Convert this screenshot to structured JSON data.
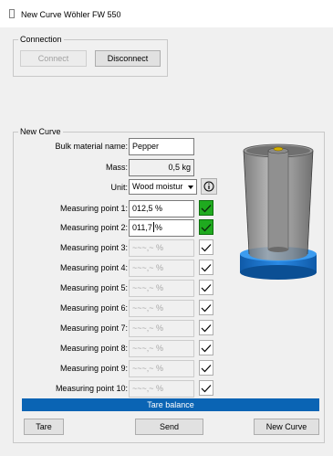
{
  "window": {
    "title": "New Curve Wöhler FW 550"
  },
  "connection": {
    "label": "Connection",
    "connect_label": "Connect",
    "disconnect_label": "Disconnect"
  },
  "curve": {
    "label": "New Curve",
    "bulk_label": "Bulk material name:",
    "bulk_value": "Pepper",
    "mass_label": "Mass:",
    "mass_value": "0,5 kg",
    "unit_label": "Unit:",
    "unit_value": "Wood moistur",
    "info_icon": "info-icon",
    "points": [
      {
        "label": "Measuring point 1:",
        "value": "012,5 %",
        "confirmed": true
      },
      {
        "label": "Measuring point 2:",
        "value_a": "011,7",
        "value_b": "%",
        "confirmed": true
      },
      {
        "label": "Measuring point 3:",
        "value": "~~~,~ %",
        "confirmed": false
      },
      {
        "label": "Measuring point 4:",
        "value": "~~~,~ %",
        "confirmed": false
      },
      {
        "label": "Measuring point 5:",
        "value": "~~~,~ %",
        "confirmed": false
      },
      {
        "label": "Measuring point 6:",
        "value": "~~~,~ %",
        "confirmed": false
      },
      {
        "label": "Measuring point 7:",
        "value": "~~~,~ %",
        "confirmed": false
      },
      {
        "label": "Measuring point 8:",
        "value": "~~~,~ %",
        "confirmed": false
      },
      {
        "label": "Measuring point 9:",
        "value": "~~~,~ %",
        "confirmed": false
      },
      {
        "label": "Measuring point 10:",
        "value": "~~~,~ %",
        "confirmed": false
      }
    ],
    "tare_bar": "Tare balance",
    "tare_label": "Tare",
    "send_label": "Send",
    "new_curve_label": "New Curve"
  },
  "colors": {
    "accent": "#0a64b4",
    "check_on": "#1faa1f",
    "cylinder_base": "#1a78d0"
  }
}
